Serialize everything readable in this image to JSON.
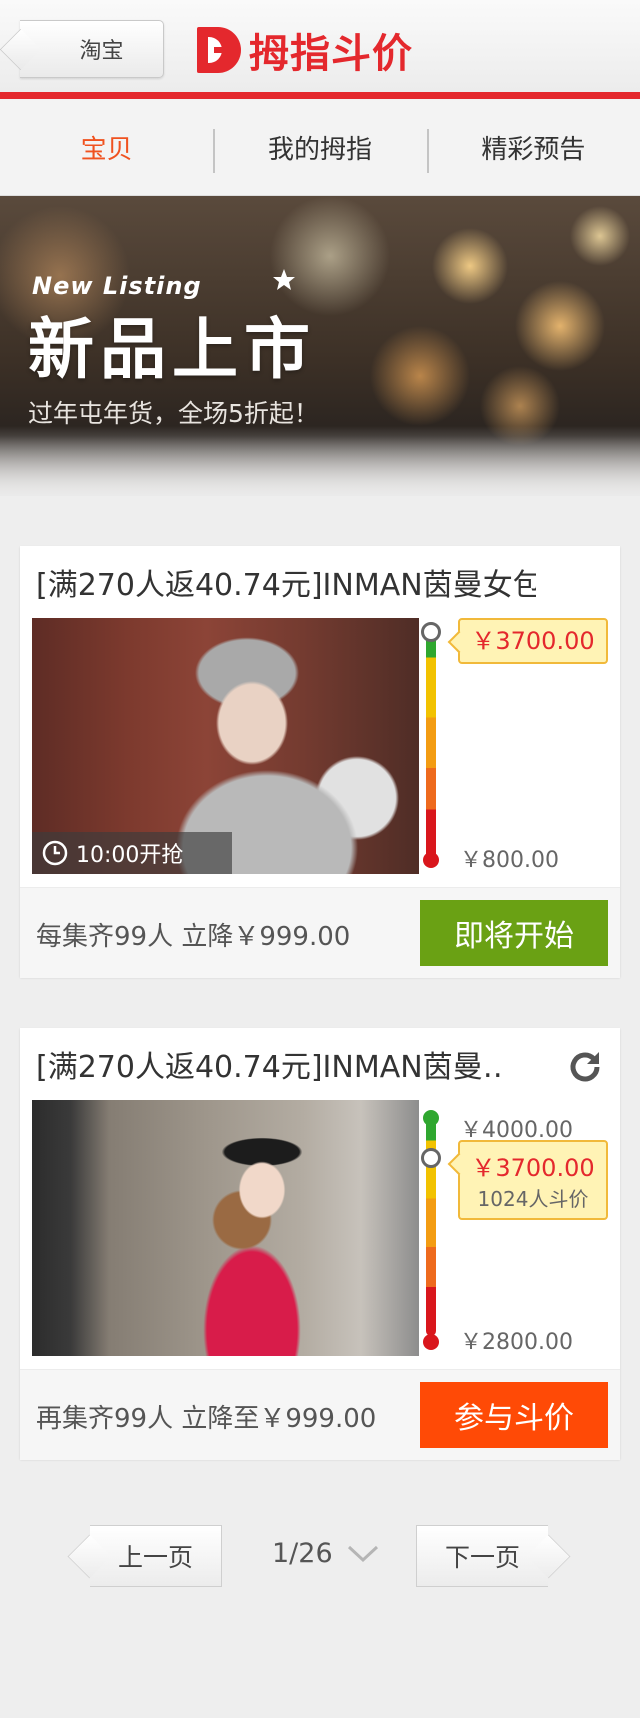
{
  "header": {
    "back_label": "淘宝",
    "logo_text": "拇指斗价",
    "accent_color": "#e4282d"
  },
  "tabs": [
    {
      "label": "宝贝",
      "active": true
    },
    {
      "label": "我的拇指",
      "active": false
    },
    {
      "label": "精彩预告",
      "active": false
    }
  ],
  "banner": {
    "english": "New Listing",
    "title": "新品上市",
    "subtitle": "过年屯年货，全场5折起！"
  },
  "products": [
    {
      "title": "[满270人返40.74元]INMAN茵曼女包…",
      "start_time": "10:00开抢",
      "current_price": "￥3700.00",
      "min_price": "￥800.00",
      "footer_text": "每集齐99人 立降￥999.00",
      "button_label": "即将开始",
      "button_color": "#6aa114"
    },
    {
      "title": "[满270人返40.74元]INMAN茵曼…",
      "max_price": "￥4000.00",
      "current_price": "￥3700.00",
      "participants": "1024人斗价",
      "min_price": "￥2800.00",
      "footer_text": "再集齐99人 立降至￥999.00",
      "button_label": "参与斗价",
      "button_color": "#ff4a06"
    }
  ],
  "pagination": {
    "prev_label": "上一页",
    "page_indicator": "1/26",
    "next_label": "下一页"
  }
}
